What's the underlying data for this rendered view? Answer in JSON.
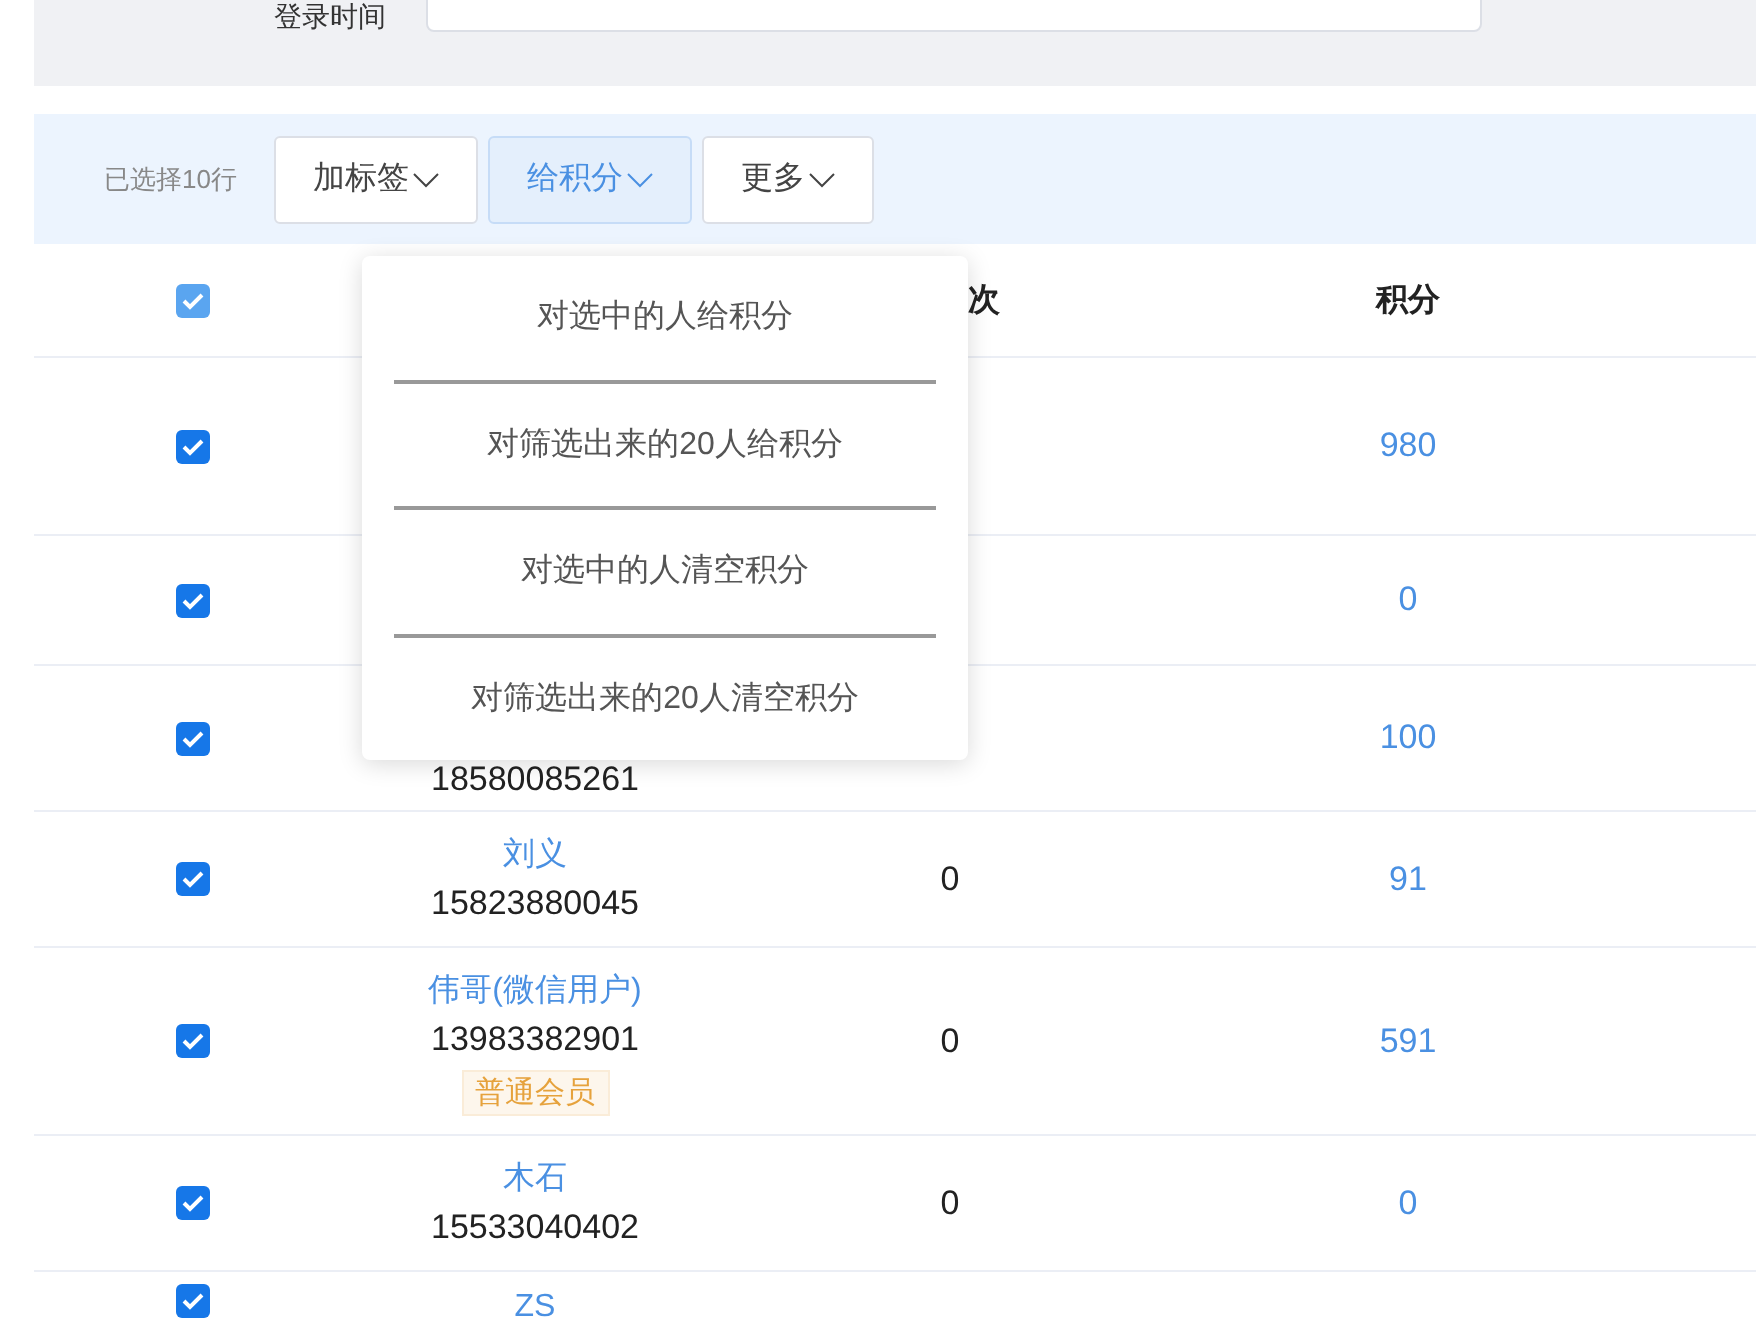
{
  "filter": {
    "label": "登录时间"
  },
  "toolbar": {
    "selection_text": "已选择10行",
    "buttons": [
      {
        "label": "加标签",
        "selected": false
      },
      {
        "label": "给积分",
        "selected": true
      },
      {
        "label": "更多",
        "selected": false
      }
    ]
  },
  "dropdown": {
    "items": [
      "对选中的人给积分",
      "对筛选出来的20人给积分",
      "对选中的人清空积分",
      "对筛选出来的20人清空积分"
    ]
  },
  "table": {
    "header_checked": true,
    "columns": [
      "",
      "",
      "次",
      "积分"
    ],
    "rows": [
      {
        "checked": true,
        "name": "",
        "phone": "",
        "tag": "",
        "column_3": "",
        "points": "980"
      },
      {
        "checked": true,
        "name": "",
        "phone": "",
        "tag": "",
        "column_3": "",
        "points": "0"
      },
      {
        "checked": true,
        "name": "",
        "phone": "18580085261",
        "tag": "",
        "column_3": "",
        "points": "100"
      },
      {
        "checked": true,
        "name": "刘义",
        "phone": "15823880045",
        "tag": "",
        "column_3": "0",
        "points": "91"
      },
      {
        "checked": true,
        "name": "伟哥(微信用户)",
        "phone": "13983382901",
        "tag": "普通会员",
        "column_3": "0",
        "points": "591"
      },
      {
        "checked": true,
        "name": "木石",
        "phone": "15533040402",
        "tag": "",
        "column_3": "0",
        "points": "0"
      },
      {
        "checked": true,
        "name": "ZS",
        "phone": "",
        "tag": "",
        "column_3": "",
        "points": ""
      }
    ]
  }
}
